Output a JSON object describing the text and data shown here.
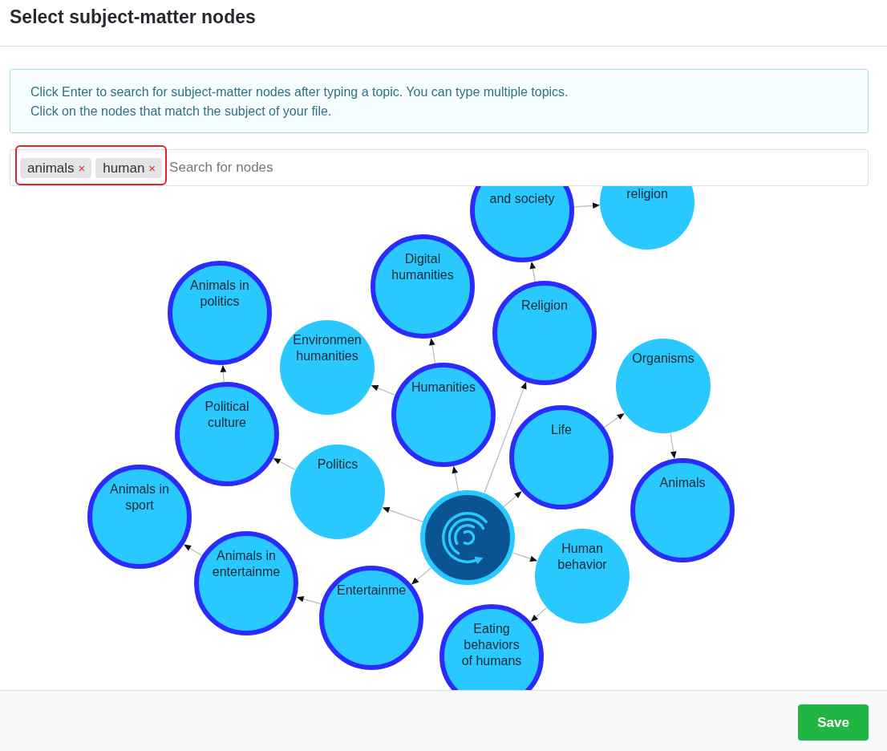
{
  "page": {
    "title": "Select subject-matter nodes"
  },
  "info": {
    "lines": [
      "Click Enter to search for subject-matter nodes after typing a topic. You can type multiple topics.",
      "Click on the nodes that match the subject of your file."
    ]
  },
  "search": {
    "tags_highlighted": true,
    "tags": [
      {
        "label": "animals",
        "remove": "×"
      },
      {
        "label": "human",
        "remove": "×"
      }
    ],
    "placeholder": "Search for nodes"
  },
  "graph": {
    "center_node": {
      "children": [
        {
          "label": "Religion",
          "selected": true,
          "children": [
            {
              "label": "and society",
              "selected": true,
              "children": [
                {
                  "label": "religion",
                  "selected": false
                }
              ]
            }
          ]
        },
        {
          "label": "Humanities",
          "selected": true,
          "children": [
            {
              "label": "Digital humanities",
              "selected": true
            },
            {
              "label": "Environmen humanities",
              "selected": false
            }
          ]
        },
        {
          "label": "Politics",
          "selected": false,
          "children": [
            {
              "label": "Political culture",
              "selected": true,
              "children": [
                {
                  "label": "Animals in politics",
                  "selected": true
                }
              ]
            }
          ]
        },
        {
          "label": "Life",
          "selected": true,
          "children": [
            {
              "label": "Organisms",
              "selected": false,
              "children": [
                {
                  "label": "Animals",
                  "selected": true
                }
              ]
            }
          ]
        },
        {
          "label": "Entertainme",
          "selected": true,
          "children": [
            {
              "label": "Animals in entertainme",
              "selected": true,
              "children": [
                {
                  "label": "Animals in sport",
                  "selected": true
                }
              ]
            }
          ]
        },
        {
          "label": "Human behavior",
          "selected": false,
          "children": [
            {
              "label": "Eating behaviors of humans",
              "selected": true
            }
          ]
        }
      ]
    }
  },
  "footer": {
    "save_button": {
      "label": "Save"
    }
  }
}
